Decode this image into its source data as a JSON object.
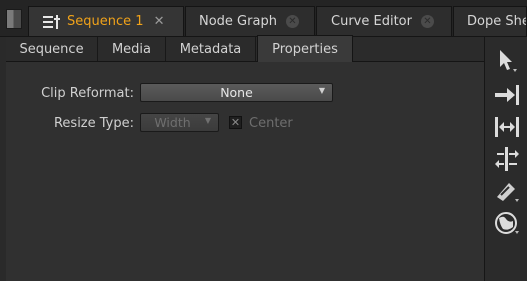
{
  "top_tabs": [
    {
      "label": "Sequence 1",
      "active": true,
      "icon": "sequence-icon"
    },
    {
      "label": "Node Graph",
      "active": false
    },
    {
      "label": "Curve Editor",
      "active": false
    },
    {
      "label": "Dope She",
      "active": false
    }
  ],
  "sub_tabs": [
    {
      "label": "Sequence"
    },
    {
      "label": "Media"
    },
    {
      "label": "Metadata"
    },
    {
      "label": "Properties",
      "active": true
    }
  ],
  "properties": {
    "clip_reformat": {
      "label": "Clip Reformat:",
      "value": "None"
    },
    "resize_type": {
      "label": "Resize Type:",
      "value": "Width",
      "disabled": true
    },
    "center": {
      "label": "Center",
      "checked": true,
      "disabled": true
    }
  },
  "tools": [
    "select-pointer-icon",
    "move-to-edit-icon",
    "slip-clip-icon",
    "slide-clip-icon",
    "razor-icon",
    "multi-tool-icon"
  ],
  "colors": {
    "active_tab_text": "#f0a21a",
    "background": "#303030"
  }
}
